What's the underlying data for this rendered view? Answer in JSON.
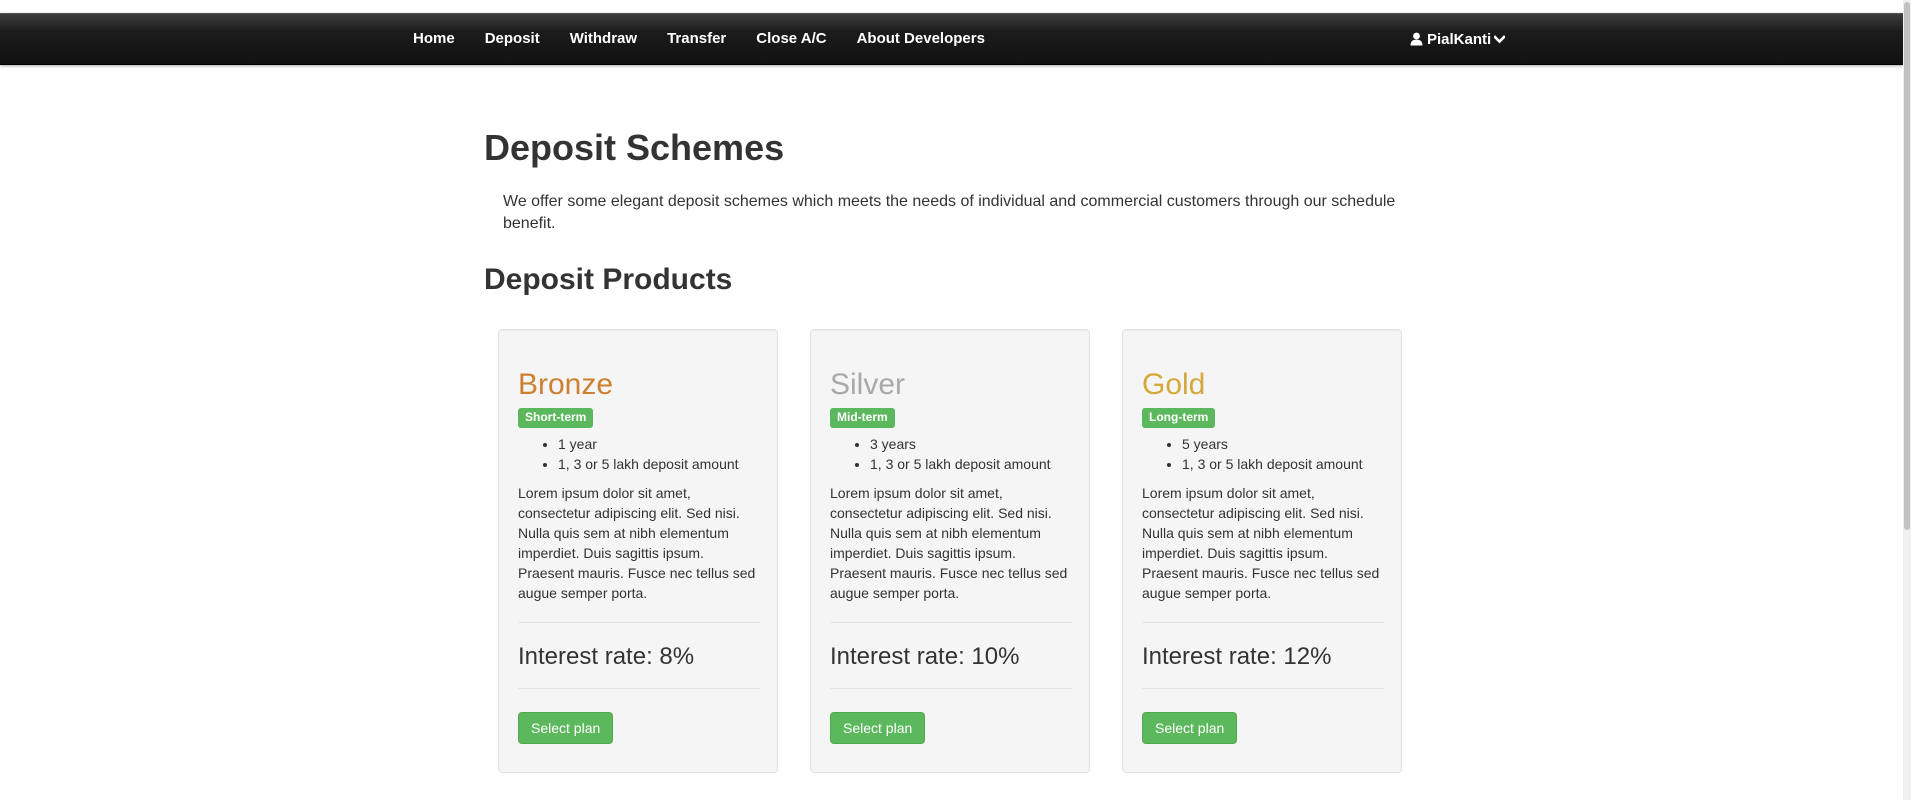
{
  "nav": {
    "items": [
      {
        "label": "Home"
      },
      {
        "label": "Deposit"
      },
      {
        "label": "Withdraw"
      },
      {
        "label": "Transfer"
      },
      {
        "label": "Close A/C"
      },
      {
        "label": "About Developers"
      }
    ],
    "user": {
      "name": "PialKanti",
      "icon": "user-icon",
      "dropdown_icon": "chevron-down-icon"
    }
  },
  "main": {
    "title": "Deposit Schemes",
    "intro": "We offer some elegant deposit schemes which meets the needs of individual and commercial customers through our schedule benefit.",
    "products_heading": "Deposit Products",
    "plans": [
      {
        "name": "Bronze",
        "name_color": "#cd7f32",
        "term": "Short-term",
        "features": [
          "1 year",
          "1, 3 or 5 lakh deposit amount"
        ],
        "description": "Lorem ipsum dolor sit amet, consectetur adipiscing elit. Sed nisi. Nulla quis sem at nibh elementum imperdiet. Duis sagittis ipsum. Praesent mauris. Fusce nec tellus sed augue semper porta.",
        "rate": "Interest rate: 8%",
        "button": "Select plan"
      },
      {
        "name": "Silver",
        "name_color": "#a9a9a9",
        "term": "Mid-term",
        "features": [
          "3 years",
          "1, 3 or 5 lakh deposit amount"
        ],
        "description": "Lorem ipsum dolor sit amet, consectetur adipiscing elit. Sed nisi. Nulla quis sem at nibh elementum imperdiet. Duis sagittis ipsum. Praesent mauris. Fusce nec tellus sed augue semper porta.",
        "rate": "Interest rate: 10%",
        "button": "Select plan"
      },
      {
        "name": "Gold",
        "name_color": "#d4a83a",
        "term": "Long-term",
        "features": [
          "5 years",
          "1, 3 or 5 lakh deposit amount"
        ],
        "description": "Lorem ipsum dolor sit amet, consectetur adipiscing elit. Sed nisi. Nulla quis sem at nibh elementum imperdiet. Duis sagittis ipsum. Praesent mauris. Fusce nec tellus sed augue semper porta.",
        "rate": "Interest rate: 12%",
        "button": "Select plan"
      }
    ]
  },
  "colors": {
    "success": "#5cb85c",
    "navbar": "#1c1c1c"
  }
}
